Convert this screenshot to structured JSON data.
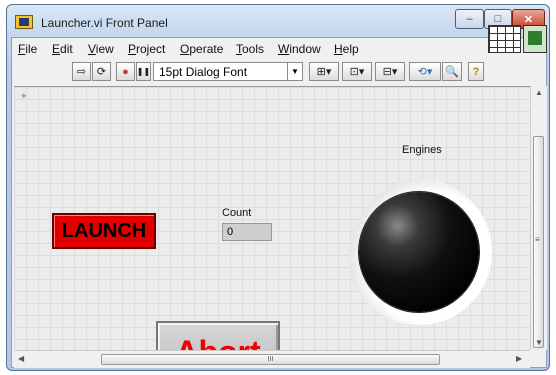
{
  "window": {
    "title": "Launcher.vi Front Panel",
    "controls": {
      "minimize": "–",
      "maximize": "□",
      "close": "✕"
    }
  },
  "menubar": [
    "File",
    "Edit",
    "View",
    "Project",
    "Operate",
    "Tools",
    "Window",
    "Help"
  ],
  "menubar_mnemonics": [
    "F",
    "E",
    "V",
    "P",
    "O",
    "T",
    "W",
    "H"
  ],
  "toolbar": {
    "run_icon": "⇨",
    "run_continuous_icon": "⟳",
    "abort_icon": "●",
    "pause_icon": "❚❚",
    "font_selector": "15pt Dialog Font",
    "align_icon": "align-objects-icon",
    "distribute_icon": "distribute-objects-icon",
    "resize_icon": "resize-objects-icon",
    "reorder_icon": "reorder-icon",
    "search_icon": "search-icon",
    "help_icon": "?"
  },
  "panel": {
    "launch_button": "LAUNCH",
    "abort_button": "Abort",
    "count_label": "Count",
    "count_value": "0",
    "engines_label": "Engines",
    "engines_led_on": false
  },
  "scrollbars": {
    "h_thumb_grip": "III",
    "v_thumb_grip": "≡"
  },
  "colors": {
    "launch_bg": "#e00000",
    "abort_text": "#ee0000",
    "led_off": "#101010"
  }
}
